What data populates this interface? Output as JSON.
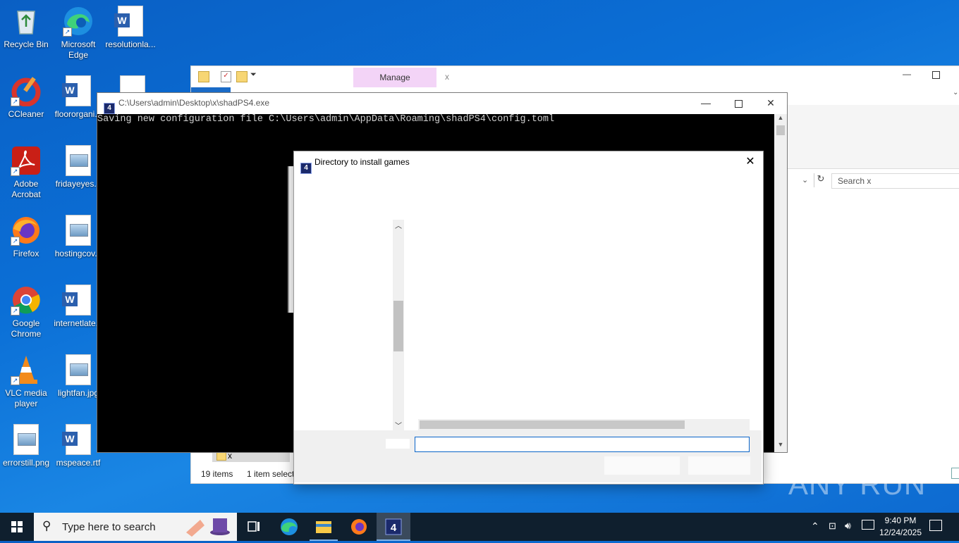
{
  "desktop": {
    "icons": [
      {
        "label": "Recycle Bin"
      },
      {
        "label": "Microsoft Edge"
      },
      {
        "label": "resolutionla..."
      },
      {
        "label": "CCleaner"
      },
      {
        "label": "floororgani..."
      },
      {
        "label": "Adobe Acrobat"
      },
      {
        "label": "fridayeyes..."
      },
      {
        "label": "Firefox"
      },
      {
        "label": "hostingcov..."
      },
      {
        "label": "Google Chrome"
      },
      {
        "label": "internetlate..."
      },
      {
        "label": "VLC media player"
      },
      {
        "label": "lightfan.jpg"
      },
      {
        "label": "errorstill.png"
      },
      {
        "label": "mspeace.rtf"
      }
    ]
  },
  "explorer": {
    "ribbon_tab_manage": "Manage",
    "ribbon_tab_x": "x",
    "search_placeholder": "Search x",
    "nav_item": "x",
    "status_items": "19 items",
    "status_selected": "1 item selecte"
  },
  "console": {
    "title": "C:\\Users\\admin\\Desktop\\x\\shadPS4.exe",
    "line1": "Saving new configuration file C:\\Users\\admin\\AppData\\Roaming\\shadPS4\\config.toml"
  },
  "dialog": {
    "title": "Directory to install games",
    "input_value": ""
  },
  "taskbar": {
    "search_placeholder": "Type here to search",
    "time": "9:40 PM",
    "date": "12/24/2025"
  },
  "watermark": "ANY RUN"
}
